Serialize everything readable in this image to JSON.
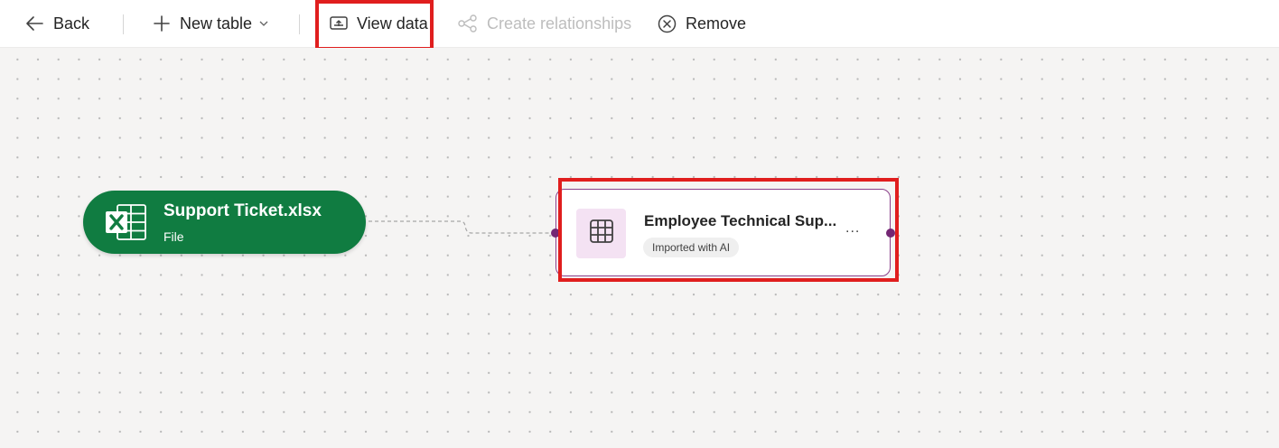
{
  "toolbar": {
    "back_label": "Back",
    "new_table_label": "New table",
    "view_data_label": "View data",
    "create_relationships_label": "Create relationships",
    "remove_label": "Remove",
    "icons": [
      "arrow-left-icon",
      "plus-icon",
      "chevron-down-icon",
      "view-data-icon",
      "relationships-icon",
      "dismiss-circle-icon"
    ]
  },
  "file_node": {
    "title": "Support Ticket.xlsx",
    "subtitle": "File",
    "icon": "excel-icon",
    "color": "#107c41"
  },
  "table_node": {
    "title": "Employee Technical Sup...",
    "badge": "Imported with AI",
    "more": "...",
    "icon": "table-grid-icon",
    "border_color": "#8a3f8a",
    "icon_bg": "#f4e2f3"
  },
  "colors": {
    "highlight": "#e01e1e",
    "canvas_bg": "#f5f4f3",
    "port": "#742774"
  }
}
